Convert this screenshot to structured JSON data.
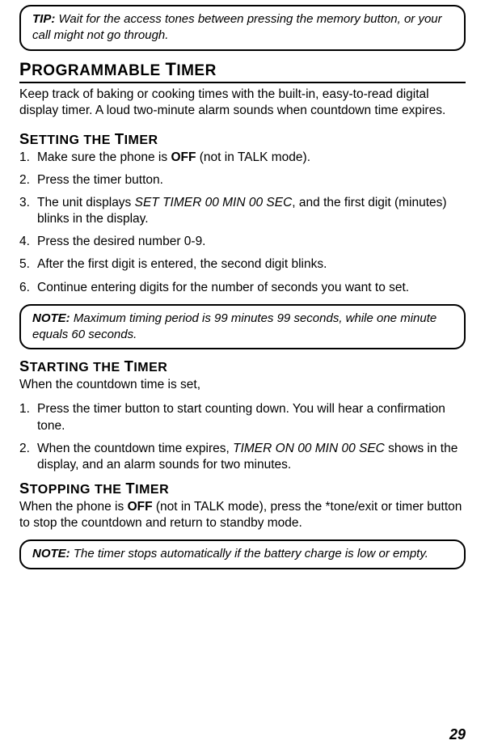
{
  "tip_box": {
    "label": "TIP:",
    "text": " Wait for the access tones between pressing the memory button, or your call might not go through."
  },
  "main_heading": {
    "first_p": "P",
    "rest_p": "ROGRAMMABLE",
    "first_t": "T",
    "rest_t": "IMER"
  },
  "intro": "Keep track of baking or cooking times with the built-in, easy-to-read digital display timer. A loud two-minute alarm sounds when countdown time expires.",
  "setting": {
    "heading": {
      "s1f": "S",
      "s1r": "ETTING THE",
      "s2f": "T",
      "s2r": "IMER"
    },
    "items": {
      "i1_pre": "Make sure the phone is ",
      "i1_bold": "OFF",
      "i1_post": " (not in TALK mode).",
      "i2": "Press the timer button.",
      "i3_pre": "The unit displays ",
      "i3_italic": "SET TIMER 00 MIN 00 SEC",
      "i3_post": ", and the first digit (minutes) blinks in the display.",
      "i4": "Press the desired number 0-9.",
      "i5": "After the first digit is entered, the second digit blinks.",
      "i6": "Continue entering digits for the number of seconds you want to set."
    }
  },
  "note1": {
    "label": "NOTE:",
    "text": " Maximum timing period is 99 minutes 99 seconds, while one minute equals 60 seconds."
  },
  "starting": {
    "heading": {
      "s1f": "S",
      "s1r": "TARTING THE",
      "s2f": "T",
      "s2r": "IMER"
    },
    "lead": "When the countdown time is set,",
    "items": {
      "i1": "Press the timer button to start counting down. You will hear a confirmation tone.",
      "i2_pre": "When the countdown time expires, ",
      "i2_italic": "TIMER ON 00 MIN 00 SEC",
      "i2_post": " shows in the display, and an alarm sounds for two minutes."
    }
  },
  "stopping": {
    "heading": {
      "s1f": "S",
      "s1r": "TOPPING THE",
      "s2f": "T",
      "s2r": "IMER"
    },
    "text_pre": "When the phone is ",
    "text_bold": "OFF",
    "text_post": " (not in TALK mode), press the *tone/exit or timer button to stop the countdown and return to standby mode."
  },
  "note2": {
    "label": "NOTE:",
    "text": " The timer stops automatically if the battery charge is low or empty."
  },
  "page_number": "29"
}
